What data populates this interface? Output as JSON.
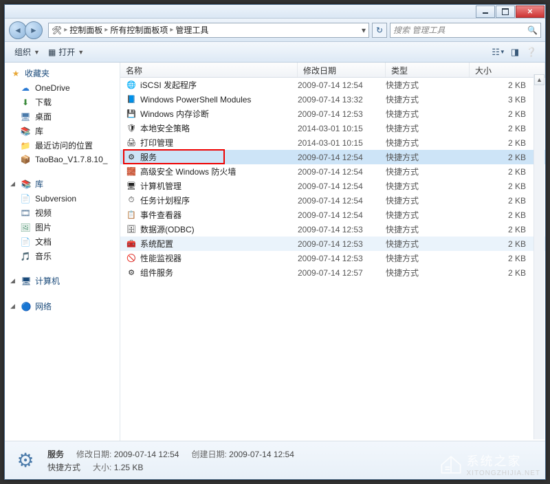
{
  "titlebar": {
    "min": "",
    "max": "",
    "close": ""
  },
  "breadcrumb": {
    "items": [
      "控制面板",
      "所有控制面板项",
      "管理工具"
    ]
  },
  "search": {
    "placeholder": "搜索 管理工具"
  },
  "toolbar": {
    "organize": "组织",
    "open": "打开"
  },
  "sidebar": {
    "favorites": {
      "label": "收藏夹",
      "items": [
        {
          "icon": "☁",
          "label": "OneDrive",
          "color": "#2a7ad4"
        },
        {
          "icon": "⬇",
          "label": "下载",
          "color": "#3a8a3a"
        },
        {
          "icon": "🖥",
          "label": "桌面",
          "color": "#4a7aaa"
        },
        {
          "icon": "📚",
          "label": "库",
          "color": "#caa23a"
        },
        {
          "icon": "📁",
          "label": "最近访问的位置",
          "color": "#caa23a"
        },
        {
          "icon": "📦",
          "label": "TaoBao_V1.7.8.10_",
          "color": "#8a2a2a"
        }
      ]
    },
    "libraries": {
      "label": "库",
      "items": [
        {
          "icon": "📄",
          "label": "Subversion",
          "color": "#6a8aaa"
        },
        {
          "icon": "🎞",
          "label": "视频",
          "color": "#5a7a9a"
        },
        {
          "icon": "🖼",
          "label": "图片",
          "color": "#5a9a7a"
        },
        {
          "icon": "📄",
          "label": "文档",
          "color": "#6a8aaa"
        },
        {
          "icon": "🎵",
          "label": "音乐",
          "color": "#5a8aba"
        }
      ]
    },
    "computer": {
      "label": "计算机"
    },
    "network": {
      "label": "网络"
    }
  },
  "columns": {
    "name": "名称",
    "date": "修改日期",
    "type": "类型",
    "size": "大小"
  },
  "files": [
    {
      "icon": "🌐",
      "name": "iSCSI 发起程序",
      "date": "2009-07-14 12:54",
      "type": "快捷方式",
      "size": "2 KB"
    },
    {
      "icon": "📘",
      "name": "Windows PowerShell Modules",
      "date": "2009-07-14 13:32",
      "type": "快捷方式",
      "size": "3 KB"
    },
    {
      "icon": "💾",
      "name": "Windows 内存诊断",
      "date": "2009-07-14 12:53",
      "type": "快捷方式",
      "size": "2 KB"
    },
    {
      "icon": "🛡",
      "name": "本地安全策略",
      "date": "2014-03-01 10:15",
      "type": "快捷方式",
      "size": "2 KB"
    },
    {
      "icon": "🖨",
      "name": "打印管理",
      "date": "2014-03-01 10:15",
      "type": "快捷方式",
      "size": "2 KB"
    },
    {
      "icon": "⚙",
      "name": "服务",
      "date": "2009-07-14 12:54",
      "type": "快捷方式",
      "size": "2 KB",
      "selected": true,
      "highlight": true
    },
    {
      "icon": "🧱",
      "name": "高级安全 Windows 防火墙",
      "date": "2009-07-14 12:54",
      "type": "快捷方式",
      "size": "2 KB"
    },
    {
      "icon": "🖥",
      "name": "计算机管理",
      "date": "2009-07-14 12:54",
      "type": "快捷方式",
      "size": "2 KB"
    },
    {
      "icon": "⏱",
      "name": "任务计划程序",
      "date": "2009-07-14 12:54",
      "type": "快捷方式",
      "size": "2 KB"
    },
    {
      "icon": "📋",
      "name": "事件查看器",
      "date": "2009-07-14 12:54",
      "type": "快捷方式",
      "size": "2 KB"
    },
    {
      "icon": "🗄",
      "name": "数据源(ODBC)",
      "date": "2009-07-14 12:53",
      "type": "快捷方式",
      "size": "2 KB"
    },
    {
      "icon": "🧰",
      "name": "系统配置",
      "date": "2009-07-14 12:53",
      "type": "快捷方式",
      "size": "2 KB",
      "hover": true
    },
    {
      "icon": "🚫",
      "name": "性能监视器",
      "date": "2009-07-14 12:53",
      "type": "快捷方式",
      "size": "2 KB"
    },
    {
      "icon": "⚙",
      "name": "组件服务",
      "date": "2009-07-14 12:57",
      "type": "快捷方式",
      "size": "2 KB"
    }
  ],
  "details": {
    "name": "服务",
    "type": "快捷方式",
    "date_k": "修改日期:",
    "date_v": "2009-07-14 12:54",
    "created_k": "创建日期:",
    "created_v": "2009-07-14 12:54",
    "size_k": "大小:",
    "size_v": "1.25 KB"
  },
  "watermark": {
    "text": "系统之家",
    "sub": "XITONGZHIJIA.NET"
  }
}
